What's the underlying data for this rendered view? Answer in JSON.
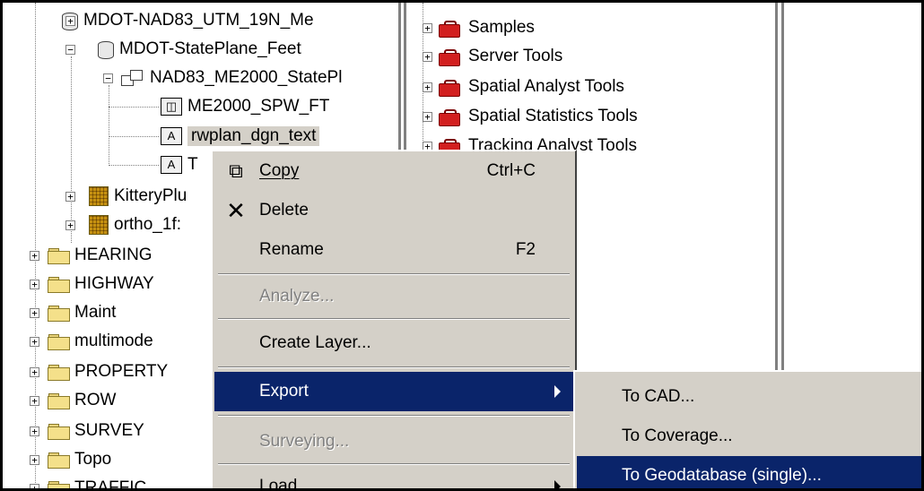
{
  "tree": {
    "items": [
      {
        "label": "MDOT-NAD83_UTM_19N_Me",
        "icon": "database-icon",
        "expander": "+"
      },
      {
        "label": "MDOT-StatePlane_Feet",
        "icon": "database-icon",
        "expander": "-"
      },
      {
        "label": "NAD83_ME2000_StatePl",
        "icon": "feature-dataset-icon",
        "expander": "-"
      },
      {
        "label": "ME2000_SPW_FT",
        "icon": "feature-class-icon"
      },
      {
        "label": "rwplan_dgn_text",
        "icon": "annotation-icon",
        "icon_text": "A",
        "selected": true
      },
      {
        "label": "T",
        "icon": "annotation-icon",
        "icon_text": "A"
      },
      {
        "label": "KitteryPlu",
        "icon": "raster-icon",
        "expander": "+"
      },
      {
        "label": "ortho_1f:",
        "icon": "raster-icon",
        "expander": "+"
      },
      {
        "label": "HEARING",
        "icon": "folder-icon",
        "expander": "+"
      },
      {
        "label": "HIGHWAY",
        "icon": "folder-icon",
        "expander": "+"
      },
      {
        "label": "Maint",
        "icon": "folder-icon",
        "expander": "+"
      },
      {
        "label": "multimode",
        "icon": "folder-icon",
        "expander": "+"
      },
      {
        "label": "PROPERTY",
        "icon": "folder-icon",
        "expander": "+"
      },
      {
        "label": "ROW",
        "icon": "folder-icon",
        "expander": "+"
      },
      {
        "label": "SURVEY",
        "icon": "folder-icon",
        "expander": "+"
      },
      {
        "label": "Topo",
        "icon": "folder-icon",
        "expander": "+"
      },
      {
        "label": "TRAFFIC",
        "icon": "folder-icon",
        "expander": "+"
      }
    ]
  },
  "toolbox": {
    "items": [
      {
        "label": "Samples",
        "icon": "toolbox-icon",
        "expander": "+"
      },
      {
        "label": "Server Tools",
        "icon": "toolbox-icon",
        "expander": "+"
      },
      {
        "label": "Spatial Analyst Tools",
        "icon": "toolbox-icon",
        "expander": "+"
      },
      {
        "label": "Spatial Statistics Tools",
        "icon": "toolbox-icon",
        "expander": "+"
      },
      {
        "label": "Tracking Analyst Tools",
        "icon": "toolbox-icon",
        "expander": "+"
      }
    ]
  },
  "context_menu": {
    "copy": {
      "label": "Copy",
      "shortcut": "Ctrl+C",
      "icon": "copy-icon"
    },
    "delete": {
      "label": "Delete",
      "icon": "delete-x-icon"
    },
    "rename": {
      "label": "Rename",
      "shortcut": "F2"
    },
    "analyze": {
      "label": "Analyze...",
      "disabled": true
    },
    "create_layer": {
      "label": "Create Layer..."
    },
    "export": {
      "label": "Export",
      "highlighted": true,
      "has_submenu": true
    },
    "surveying": {
      "label": "Surveying...",
      "disabled": true
    },
    "load": {
      "label": "Load",
      "has_submenu": true
    }
  },
  "export_submenu": {
    "to_cad": {
      "label": "To CAD..."
    },
    "to_coverage": {
      "label": "To Coverage..."
    },
    "to_geodatabase": {
      "label": "To Geodatabase (single)...",
      "highlighted": true
    }
  },
  "colors": {
    "highlight": "#0a246a",
    "menu_bg": "#d4d0c8",
    "toolbox_red": "#d21f1f",
    "folder_yellow": "#f4e08a"
  }
}
